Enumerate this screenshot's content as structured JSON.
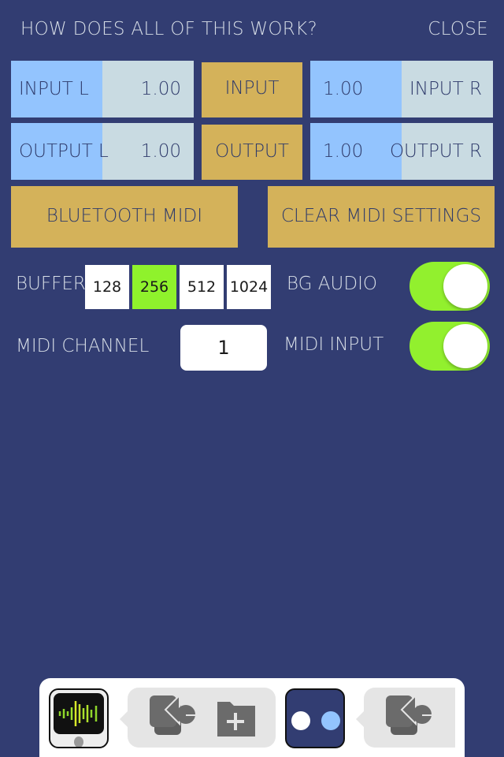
{
  "header": {
    "help_link": "HOW DOES ALL OF THIS WORK?",
    "close_label": "CLOSE"
  },
  "levels": {
    "input_left": {
      "label": "INPUT L",
      "value": "1.00",
      "fill_fraction": 0.5
    },
    "input_right": {
      "label": "INPUT R",
      "value": "1.00",
      "fill_fraction": 0.5
    },
    "output_left": {
      "label": "OUTPUT L",
      "value": "1.00",
      "fill_fraction": 0.5
    },
    "output_right": {
      "label": "OUTPUT R",
      "value": "1.00",
      "fill_fraction": 0.5
    },
    "input_button": "INPUT",
    "output_button": "OUTPUT"
  },
  "midi_buttons": {
    "bluetooth": "BLUETOOTH MIDI",
    "clear": "CLEAR MIDI SETTINGS"
  },
  "buffer": {
    "label": "BUFFER",
    "options": [
      "128",
      "256",
      "512",
      "1024"
    ],
    "selected": "256"
  },
  "bg_audio": {
    "label": "BG AUDIO",
    "on": true
  },
  "midi_channel": {
    "label": "MIDI CHANNEL",
    "value": "1"
  },
  "midi_input": {
    "label": "MIDI INPUT",
    "on": true
  },
  "colors": {
    "background": "#323d72",
    "level_fill": "#93c4fe",
    "level_track": "#c9dbe2",
    "gold": "#d4b25a",
    "selected_green": "#8ff22c",
    "toggle_on": "#92f02e"
  },
  "dock": {
    "icons": [
      "waveform-app-icon",
      "audio-unit-icon",
      "add-folder-icon",
      "dots-app-icon",
      "audio-unit-icon"
    ]
  }
}
